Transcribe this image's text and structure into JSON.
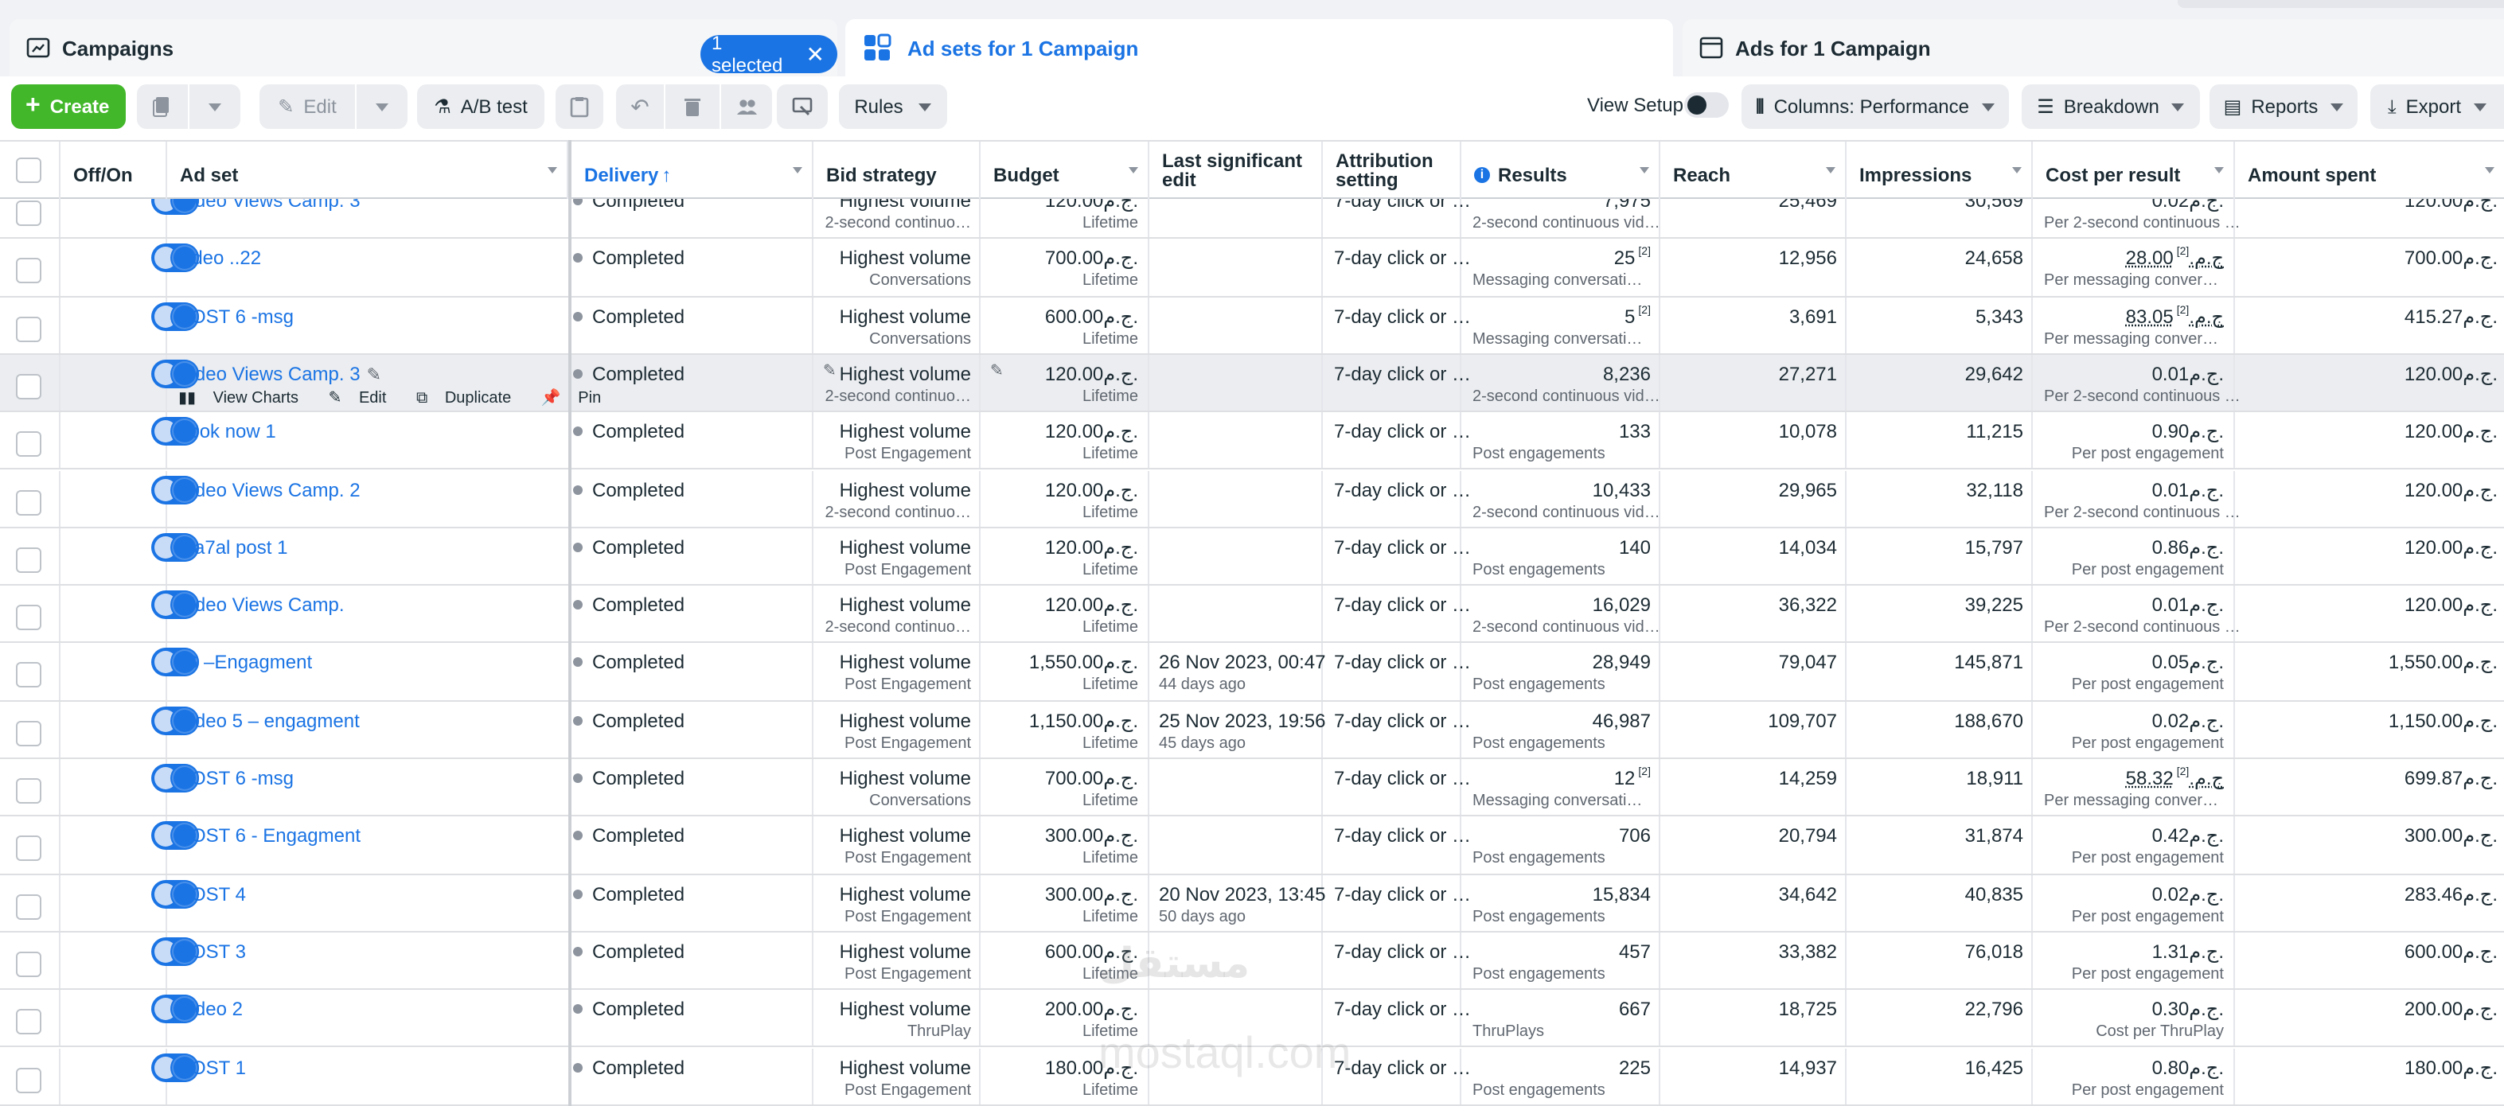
{
  "tabs": {
    "campaigns": "Campaigns",
    "selected_pill": "1 selected",
    "adsets": "Ad sets for 1 Campaign",
    "ads": "Ads for 1 Campaign"
  },
  "toolbar": {
    "create": "Create",
    "edit": "Edit",
    "ab_test": "A/B test",
    "rules": "Rules",
    "view_setup": "View Setup",
    "columns": "Columns: Performance",
    "breakdown": "Breakdown",
    "reports": "Reports",
    "export": "Export"
  },
  "columns": {
    "offon": "Off/On",
    "adset": "Ad set",
    "delivery": "Delivery",
    "bid_strategy": "Bid strategy",
    "budget": "Budget",
    "last_edit_1": "Last significant",
    "last_edit_2": "edit",
    "attribution_1": "Attribution",
    "attribution_2": "setting",
    "results": "Results",
    "reach": "Reach",
    "impressions": "Impressions",
    "cost_per_result": "Cost per result",
    "amount_spent": "Amount spent"
  },
  "hover_actions": {
    "view_charts": "View Charts",
    "edit": "Edit",
    "duplicate": "Duplicate",
    "pin": "Pin"
  },
  "rows": [
    {
      "name": "Video Views Camp. 3",
      "delivery": "Completed",
      "bid": "Highest volume",
      "bid_sub": "2-second continuo…",
      "budget": "120.00ج.م.",
      "budget_sub": "Lifetime",
      "edit": "",
      "edit_sub": "",
      "attribution": "7-day click or …",
      "results": "7,975",
      "results_sup": "",
      "results_sub": "2-second continuous vid…",
      "reach": "25,469",
      "impressions": "30,569",
      "cpr": "0.02ج.م.",
      "cpr_sup": "",
      "cpr_sub": "Per 2-second continuous …",
      "spent": "120.00ج.م."
    },
    {
      "name": "video ..22",
      "delivery": "Completed",
      "bid": "Highest volume",
      "bid_sub": "Conversations",
      "budget": "700.00ج.م.",
      "budget_sub": "Lifetime",
      "edit": "",
      "edit_sub": "",
      "attribution": "7-day click or …",
      "results": "25",
      "results_sup": "[2]",
      "results_sub": "Messaging conversati…",
      "reach": "12,956",
      "impressions": "24,658",
      "cpr": "28.00ج.م.",
      "cpr_sup": "[2]",
      "cpr_sub": "Per messaging conver…",
      "spent": "700.00ج.م."
    },
    {
      "name": "POST 6 -msg",
      "delivery": "Completed",
      "bid": "Highest volume",
      "bid_sub": "Conversations",
      "budget": "600.00ج.م.",
      "budget_sub": "Lifetime",
      "edit": "",
      "edit_sub": "",
      "attribution": "7-day click or …",
      "results": "5",
      "results_sup": "[2]",
      "results_sub": "Messaging conversati…",
      "reach": "3,691",
      "impressions": "5,343",
      "cpr": "83.05ج.م.",
      "cpr_sup": "[2]",
      "cpr_sub": "Per messaging conver…",
      "spent": "415.27ج.م."
    },
    {
      "name": "Video Views Camp. 3",
      "delivery": "Completed",
      "bid": "Highest volume",
      "bid_sub": "2-second continuo…",
      "budget": "120.00ج.م.",
      "budget_sub": "Lifetime",
      "edit": "",
      "edit_sub": "",
      "attribution": "7-day click or …",
      "results": "8,236",
      "results_sup": "",
      "results_sub": "2-second continuous vid…",
      "reach": "27,271",
      "impressions": "29,642",
      "cpr": "0.01ج.م.",
      "cpr_sup": "",
      "cpr_sub": "Per 2-second continuous …",
      "spent": "120.00ج.م."
    },
    {
      "name": "book now 1",
      "delivery": "Completed",
      "bid": "Highest volume",
      "bid_sub": "Post Engagement",
      "budget": "120.00ج.م.",
      "budget_sub": "Lifetime",
      "edit": "",
      "edit_sub": "",
      "attribution": "7-day click or …",
      "results": "133",
      "results_sup": "",
      "results_sub": "Post engagements",
      "reach": "10,078",
      "impressions": "11,215",
      "cpr": "0.90ج.م.",
      "cpr_sup": "",
      "cpr_sub": "Per post engagement",
      "spent": "120.00ج.م."
    },
    {
      "name": "Video Views Camp. 2",
      "delivery": "Completed",
      "bid": "Highest volume",
      "bid_sub": "2-second continuo…",
      "budget": "120.00ج.م.",
      "budget_sub": "Lifetime",
      "edit": "",
      "edit_sub": "",
      "attribution": "7-day click or …",
      "results": "10,433",
      "results_sup": "",
      "results_sub": "2-second continuous vid…",
      "reach": "29,965",
      "impressions": "32,118",
      "cpr": "0.01ج.م.",
      "cpr_sup": "",
      "cpr_sub": "Per 2-second continuous …",
      "spent": "120.00ج.م."
    },
    {
      "name": "ma7al post 1",
      "delivery": "Completed",
      "bid": "Highest volume",
      "bid_sub": "Post Engagement",
      "budget": "120.00ج.م.",
      "budget_sub": "Lifetime",
      "edit": "",
      "edit_sub": "",
      "attribution": "7-day click or …",
      "results": "140",
      "results_sup": "",
      "results_sub": "Post engagements",
      "reach": "14,034",
      "impressions": "15,797",
      "cpr": "0.86ج.م.",
      "cpr_sup": "",
      "cpr_sub": "Per post engagement",
      "spent": "120.00ج.م."
    },
    {
      "name": "Video Views Camp.",
      "delivery": "Completed",
      "bid": "Highest volume",
      "bid_sub": "2-second continuo…",
      "budget": "120.00ج.م.",
      "budget_sub": "Lifetime",
      "edit": "",
      "edit_sub": "",
      "attribution": "7-day click or …",
      "results": "16,029",
      "results_sup": "",
      "results_sub": "2-second continuous vid…",
      "reach": "36,322",
      "impressions": "39,225",
      "cpr": "0.01ج.م.",
      "cpr_sup": "",
      "cpr_sub": "Per 2-second continuous …",
      "spent": "120.00ج.م."
    },
    {
      "name": "IG –Engagment",
      "delivery": "Completed",
      "bid": "Highest volume",
      "bid_sub": "Post Engagement",
      "budget": "1,550.00ج.م.",
      "budget_sub": "Lifetime",
      "edit": "26 Nov 2023, 00:47",
      "edit_sub": "44 days ago",
      "attribution": "7-day click or …",
      "results": "28,949",
      "results_sup": "",
      "results_sub": "Post engagements",
      "reach": "79,047",
      "impressions": "145,871",
      "cpr": "0.05ج.م.",
      "cpr_sup": "",
      "cpr_sub": "Per post engagement",
      "spent": "1,550.00ج.م."
    },
    {
      "name": "Video 5 – engagment",
      "delivery": "Completed",
      "bid": "Highest volume",
      "bid_sub": "Post Engagement",
      "budget": "1,150.00ج.م.",
      "budget_sub": "Lifetime",
      "edit": "25 Nov 2023, 19:56",
      "edit_sub": "45 days ago",
      "attribution": "7-day click or …",
      "results": "46,987",
      "results_sup": "",
      "results_sub": "Post engagements",
      "reach": "109,707",
      "impressions": "188,670",
      "cpr": "0.02ج.م.",
      "cpr_sup": "",
      "cpr_sub": "Per post engagement",
      "spent": "1,150.00ج.م."
    },
    {
      "name": "POST 6 -msg",
      "delivery": "Completed",
      "bid": "Highest volume",
      "bid_sub": "Conversations",
      "budget": "700.00ج.م.",
      "budget_sub": "Lifetime",
      "edit": "",
      "edit_sub": "",
      "attribution": "7-day click or …",
      "results": "12",
      "results_sup": "[2]",
      "results_sub": "Messaging conversati…",
      "reach": "14,259",
      "impressions": "18,911",
      "cpr": "58.32ج.م.",
      "cpr_sup": "[2]",
      "cpr_sub": "Per messaging conver…",
      "spent": "699.87ج.م."
    },
    {
      "name": "POST 6 - Engagment",
      "delivery": "Completed",
      "bid": "Highest volume",
      "bid_sub": "Post Engagement",
      "budget": "300.00ج.م.",
      "budget_sub": "Lifetime",
      "edit": "",
      "edit_sub": "",
      "attribution": "7-day click or …",
      "results": "706",
      "results_sup": "",
      "results_sub": "Post engagements",
      "reach": "20,794",
      "impressions": "31,874",
      "cpr": "0.42ج.م.",
      "cpr_sup": "",
      "cpr_sub": "Per post engagement",
      "spent": "300.00ج.م."
    },
    {
      "name": "POST 4",
      "delivery": "Completed",
      "bid": "Highest volume",
      "bid_sub": "Post Engagement",
      "budget": "300.00ج.م.",
      "budget_sub": "Lifetime",
      "edit": "20 Nov 2023, 13:45",
      "edit_sub": "50 days ago",
      "attribution": "7-day click or …",
      "results": "15,834",
      "results_sup": "",
      "results_sub": "Post engagements",
      "reach": "34,642",
      "impressions": "40,835",
      "cpr": "0.02ج.م.",
      "cpr_sup": "",
      "cpr_sub": "Per post engagement",
      "spent": "283.46ج.م."
    },
    {
      "name": "POST 3",
      "delivery": "Completed",
      "bid": "Highest volume",
      "bid_sub": "Post Engagement",
      "budget": "600.00ج.م.",
      "budget_sub": "Lifetime",
      "edit": "",
      "edit_sub": "",
      "attribution": "7-day click or …",
      "results": "457",
      "results_sup": "",
      "results_sub": "Post engagements",
      "reach": "33,382",
      "impressions": "76,018",
      "cpr": "1.31ج.م.",
      "cpr_sup": "",
      "cpr_sub": "Per post engagement",
      "spent": "600.00ج.م."
    },
    {
      "name": "Video 2",
      "delivery": "Completed",
      "bid": "Highest volume",
      "bid_sub": "ThruPlay",
      "budget": "200.00ج.م.",
      "budget_sub": "Lifetime",
      "edit": "",
      "edit_sub": "",
      "attribution": "7-day click or …",
      "results": "667",
      "results_sup": "",
      "results_sub": "ThruPlays",
      "reach": "18,725",
      "impressions": "22,796",
      "cpr": "0.30ج.م.",
      "cpr_sup": "",
      "cpr_sub": "Cost per ThruPlay",
      "spent": "200.00ج.م."
    },
    {
      "name": "POST 1",
      "delivery": "Completed",
      "bid": "Highest volume",
      "bid_sub": "Post Engagement",
      "budget": "180.00ج.م.",
      "budget_sub": "Lifetime",
      "edit": "",
      "edit_sub": "",
      "attribution": "7-day click or …",
      "results": "225",
      "results_sup": "",
      "results_sub": "Post engagements",
      "reach": "14,937",
      "impressions": "16,425",
      "cpr": "0.80ج.م.",
      "cpr_sup": "",
      "cpr_sub": "Per post engagement",
      "spent": "180.00ج.م."
    }
  ],
  "hover_row_index": 3,
  "watermark": {
    "arabic": "مستقل",
    "latin": "mostaql.com"
  },
  "colors": {
    "accent": "#1b74e4",
    "create": "#42b72a",
    "hover_row": "#ebedf0"
  }
}
